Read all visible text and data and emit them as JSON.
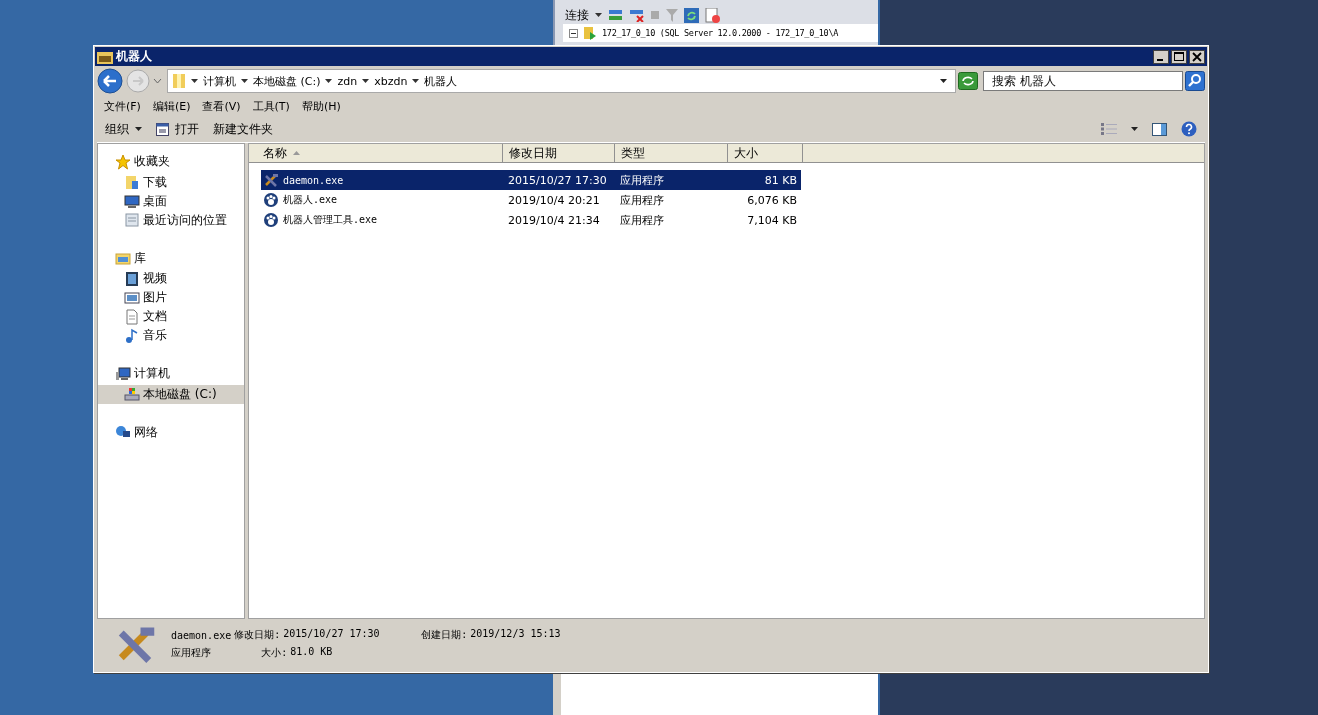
{
  "background_window": {
    "toolbar": {
      "connect": "连接"
    },
    "tree_item": {
      "label": "172_17_0_10 (SQL Server 12.0.2000 - 172_17_0_10\\A",
      "expanded": true
    }
  },
  "window": {
    "title": "机器人"
  },
  "address": {
    "crumbs": [
      "计算机",
      "本地磁盘 (C:)",
      "zdn",
      "xbzdn",
      "机器人"
    ],
    "search_placeholder": "搜索 机器人"
  },
  "menu": [
    "文件(F)",
    "编辑(E)",
    "查看(V)",
    "工具(T)",
    "帮助(H)"
  ],
  "toolbar": [
    {
      "kind": "dropdown",
      "label": "组织"
    },
    {
      "kind": "icon",
      "label": "打开"
    },
    {
      "kind": "plain",
      "label": "新建文件夹"
    }
  ],
  "sidebar": {
    "groups": [
      {
        "label": "收藏夹",
        "children": [
          {
            "label": "下载",
            "selected": false
          },
          {
            "label": "桌面",
            "selected": false
          },
          {
            "label": "最近访问的位置",
            "selected": false
          }
        ]
      },
      {
        "label": "库",
        "children": [
          {
            "label": "视频",
            "selected": false
          },
          {
            "label": "图片",
            "selected": false
          },
          {
            "label": "文档",
            "selected": false
          },
          {
            "label": "音乐",
            "selected": false
          }
        ]
      },
      {
        "label": "计算机",
        "children": [
          {
            "label": "本地磁盘 (C:)",
            "selected": true
          }
        ]
      },
      {
        "label": "网络"
      }
    ]
  },
  "table": {
    "columns": [
      {
        "label": "名称",
        "sorted": true
      },
      {
        "label": "修改日期",
        "sorted": false
      },
      {
        "label": "类型",
        "sorted": false
      },
      {
        "label": "大小",
        "sorted": false
      }
    ],
    "rows": [
      {
        "kind": "tool",
        "name": "daemon.exe",
        "date": "2015/10/27 17:30",
        "type": "应用程序",
        "size": "81 KB",
        "selected": true
      },
      {
        "kind": "app",
        "name": "机器人.exe",
        "date": "2019/10/4 20:21",
        "type": "应用程序",
        "size": "6,076 KB",
        "selected": false
      },
      {
        "kind": "app",
        "name": "机器人管理工具.exe",
        "date": "2019/10/4 21:34",
        "type": "应用程序",
        "size": "7,104 KB",
        "selected": false
      }
    ]
  },
  "details": {
    "name": "daemon.exe",
    "type": "应用程序",
    "modified_label": "修改日期:",
    "modified": "2015/10/27 17:30",
    "size_label": "大小:",
    "size": "81.0 KB",
    "created_label": "创建日期:",
    "created": "2019/12/3 15:13"
  }
}
